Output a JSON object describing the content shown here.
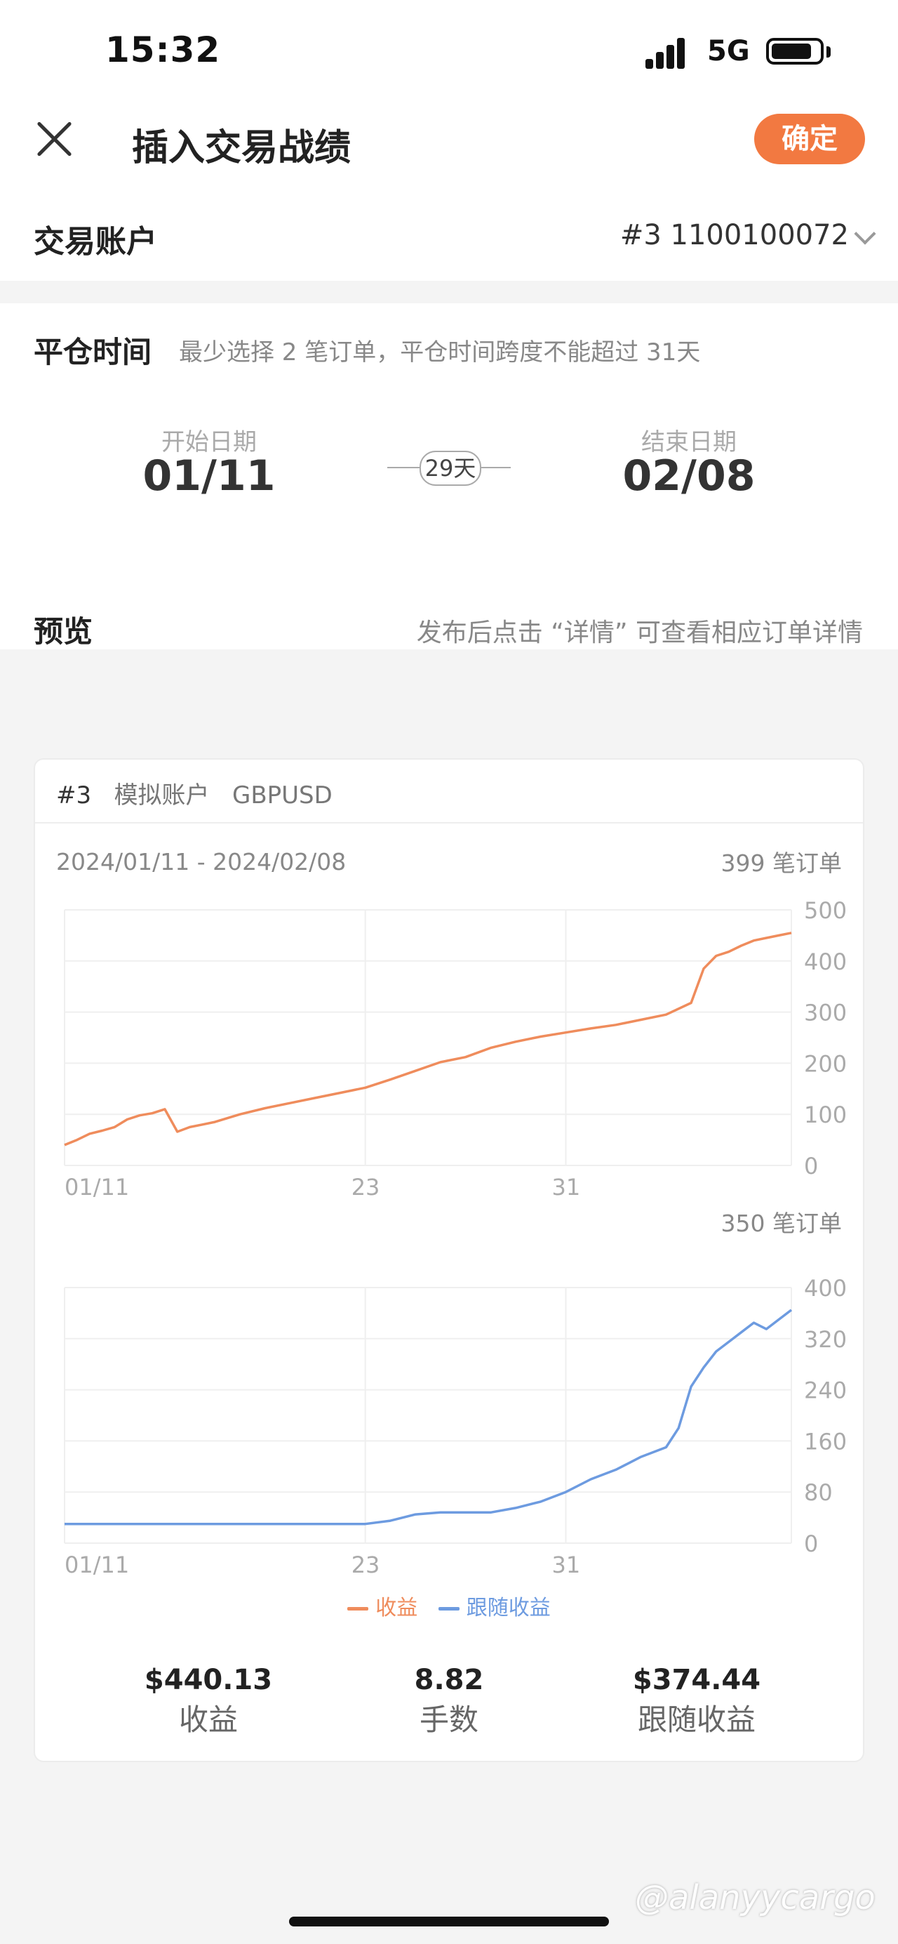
{
  "status_bar": {
    "time": "15:32",
    "network": "5G",
    "battery_level": 0.85
  },
  "header": {
    "title": "插入交易战绩",
    "confirm_label": "确定"
  },
  "account": {
    "label": "交易账户",
    "value": "#3 1100100072"
  },
  "close_time": {
    "label": "平仓时间",
    "hint": "最少选择 2 笔订单，平仓时间跨度不能超过 31天",
    "start_label": "开始日期",
    "start_value": "01/11",
    "end_label": "结束日期",
    "end_value": "02/08",
    "span": "29天"
  },
  "preview": {
    "label": "预览",
    "hint": "发布后点击 “详情” 可查看相应订单详情"
  },
  "card": {
    "account_no": "#3",
    "account_type": "模拟账户",
    "symbol": "GBPUSD",
    "date_range": "2024/01/11 - 2024/02/08",
    "orders_top": "399 笔订单",
    "orders_bottom": "350 笔订单"
  },
  "chart_data": [
    {
      "type": "line",
      "ylim": [
        0,
        500
      ],
      "yticks": [
        "500",
        "400",
        "300",
        "200",
        "100",
        "0"
      ],
      "xticks": [
        "01/11",
        "23",
        "31"
      ],
      "xtick_pos": [
        0,
        12,
        20
      ],
      "x_range": [
        0,
        29
      ],
      "series": [
        {
          "name": "收益",
          "color": "#ef8c5c",
          "x": [
            0,
            0.5,
            1,
            1.5,
            2,
            2.5,
            3,
            3.5,
            4,
            4.5,
            5,
            5.5,
            6,
            7,
            8,
            9,
            10,
            11,
            12,
            13,
            14,
            15,
            16,
            17,
            18,
            19,
            20,
            21,
            22,
            23,
            24,
            25,
            25.5,
            26,
            26.5,
            27,
            27.5,
            28,
            28.5,
            29
          ],
          "y": [
            40,
            50,
            62,
            68,
            75,
            90,
            98,
            102,
            110,
            66,
            75,
            80,
            85,
            100,
            112,
            122,
            132,
            142,
            152,
            168,
            185,
            202,
            212,
            230,
            242,
            252,
            260,
            268,
            275,
            285,
            295,
            318,
            385,
            410,
            418,
            430,
            440,
            445,
            450,
            455
          ]
        }
      ]
    },
    {
      "type": "line",
      "ylim": [
        0,
        400
      ],
      "yticks": [
        "400",
        "320",
        "240",
        "160",
        "80",
        "0"
      ],
      "xticks": [
        "01/11",
        "23",
        "31"
      ],
      "xtick_pos": [
        0,
        12,
        20
      ],
      "x_range": [
        0,
        29
      ],
      "series": [
        {
          "name": "跟随收益",
          "color": "#6d9be0",
          "x": [
            0,
            5,
            10,
            11,
            12,
            13,
            14,
            15,
            16,
            17,
            18,
            19,
            20,
            21,
            22,
            22.5,
            23,
            24,
            24.5,
            25,
            25.5,
            26,
            26.5,
            27,
            27.5,
            28,
            28.5,
            29
          ],
          "y": [
            30,
            30,
            30,
            30,
            30,
            35,
            45,
            48,
            48,
            48,
            55,
            65,
            80,
            100,
            115,
            125,
            135,
            150,
            180,
            245,
            275,
            300,
            315,
            330,
            345,
            335,
            350,
            365
          ]
        }
      ]
    }
  ],
  "legend": [
    {
      "label": "收益",
      "color": "#ef8c5c"
    },
    {
      "label": "跟随收益",
      "color": "#6d9be0"
    }
  ],
  "stats": [
    {
      "value": "$440.13",
      "label": "收益"
    },
    {
      "value": "8.82",
      "label": "手数"
    },
    {
      "value": "$374.44",
      "label": "跟随收益"
    }
  ],
  "watermark": "@alanyycargo"
}
